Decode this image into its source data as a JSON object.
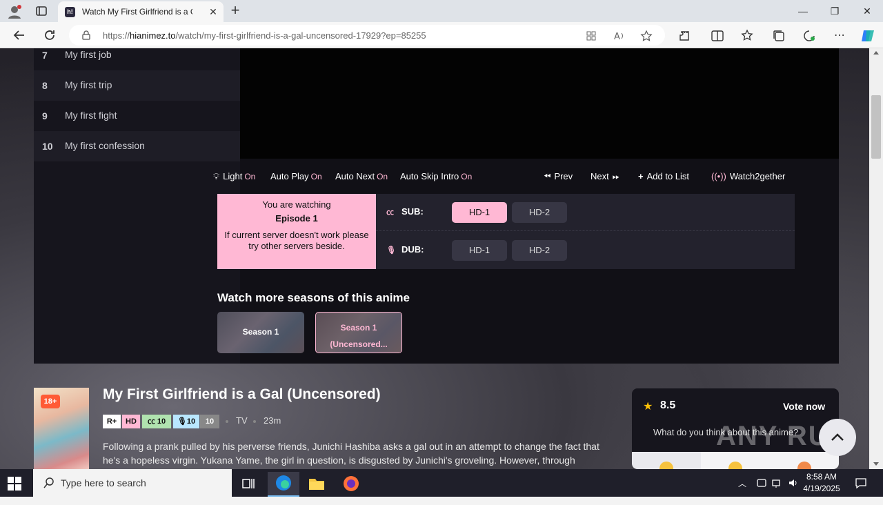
{
  "browser": {
    "tab_title": "Watch My First Girlfriend is a Gal",
    "url_prefix": "https://",
    "url_host": "hianimez.to",
    "url_path": "/watch/my-first-girlfriend-is-a-gal-uncensored-17929?ep=85255",
    "favicon_text": "h!"
  },
  "episodes": [
    {
      "num": "7",
      "title": "My first job"
    },
    {
      "num": "8",
      "title": "My first trip"
    },
    {
      "num": "9",
      "title": "My first fight"
    },
    {
      "num": "10",
      "title": "My first confession"
    }
  ],
  "controls": {
    "light": "Light",
    "light_state": "On",
    "autoplay": "Auto Play",
    "autoplay_state": "On",
    "autonext": "Auto Next",
    "autonext_state": "On",
    "autoskip": "Auto Skip Intro",
    "autoskip_state": "On",
    "prev": "Prev",
    "next": "Next",
    "add_to_list": "Add to List",
    "watch2gether": "Watch2gether"
  },
  "notice": {
    "line1": "You are watching",
    "episode": "Episode 1",
    "line3": "If current server doesn't work please try other servers beside."
  },
  "servers": {
    "sub_label": "SUB:",
    "dub_label": "DUB:",
    "sub": [
      "HD-1",
      "HD-2"
    ],
    "dub": [
      "HD-1",
      "HD-2"
    ]
  },
  "seasons": {
    "title": "Watch more seasons of this anime",
    "items": [
      "Season 1",
      "Season 1 (Uncensored..."
    ]
  },
  "anime": {
    "age_badge": "18+",
    "title": "My First Girlfriend is a Gal (Uncensored)",
    "rating_tag": "R+",
    "quality_tag": "HD",
    "sub_count": "10",
    "dub_count": "10",
    "eps_count": "10",
    "type": "TV",
    "duration": "23m",
    "synopsis": "Following a prank pulled by his perverse friends, Junichi Hashiba asks a gal out in an attempt to change the fact that he's a hopeless virgin. Yukana Yame, the girl in question, is disgusted by Junichi's groveling. However, through"
  },
  "vote": {
    "score": "8.5",
    "vote_now": "Vote now",
    "question": "What do you think about this anime?"
  },
  "watermark": "ANY RUN",
  "taskbar": {
    "search_placeholder": "Type here to search",
    "time": "8:58 AM",
    "date": "4/19/2025"
  },
  "colors": {
    "accent_pink": "#ffb8d4",
    "page_bg": "#111016",
    "age_badge": "#ff5a36"
  }
}
